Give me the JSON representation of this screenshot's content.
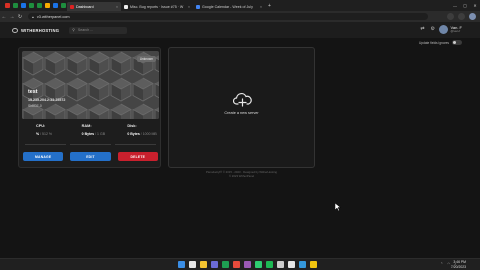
{
  "browser": {
    "pinned_colors": [
      "#d93025",
      "#1e8e3e",
      "#1a73e8",
      "#1e8e3e",
      "#1e8e3e",
      "#f9ab00",
      "#1a73e8",
      "#1e8e3e"
    ],
    "tabs": [
      {
        "label": "Dashboard",
        "color": "#d22",
        "active": true
      },
      {
        "label": "Misc. Bug reports · Issue #75 · W",
        "color": "#eee",
        "active": false
      },
      {
        "label": "Google Calendar - Week of July",
        "color": "#4285f4",
        "active": false
      }
    ],
    "tab_close": "×",
    "new_tab": "+",
    "url": "v3.witherpanel.com"
  },
  "app": {
    "logo_text": "WITHERHOSTING",
    "search_placeholder": "Search ...",
    "user_name": "Van. F",
    "user_sub": "@van.f",
    "toggle_label": "Update fields ignores"
  },
  "server": {
    "name": "test",
    "badge": "Unknown",
    "address": "15.235.204.2:33:25572",
    "node": "ShbCE-0",
    "stats": [
      {
        "label": "CPU:",
        "value": "%",
        "limit": "/ 512 %"
      },
      {
        "label": "RAM:",
        "value": "0 Bytes",
        "limit": "/ 1 GB"
      },
      {
        "label": "Disk:",
        "value": "0 Bytes",
        "limit": "/ 1000 MB"
      }
    ],
    "buttons": {
      "manage": "MANAGE",
      "edit": "EDIT",
      "delete": "DELETE"
    }
  },
  "create": {
    "label": "Create a new server"
  },
  "footer": {
    "line1": "Pterodactyl® © 2015 - 2023 · Designed by WitherHosting",
    "line2": "© 2023 WitherPanel"
  },
  "taskbar": {
    "icon_colors": [
      "#3a8ee6",
      "#e6e6e6",
      "#f4c430",
      "#6b6bd6",
      "#1e9e52",
      "#e64b3c",
      "#9b59b6",
      "#2ecc71",
      "#1db954",
      "#ccc",
      "#e6e6e6",
      "#3498db",
      "#f1c40f"
    ],
    "time": "3:46 PM",
    "date": "7/20/2023"
  }
}
